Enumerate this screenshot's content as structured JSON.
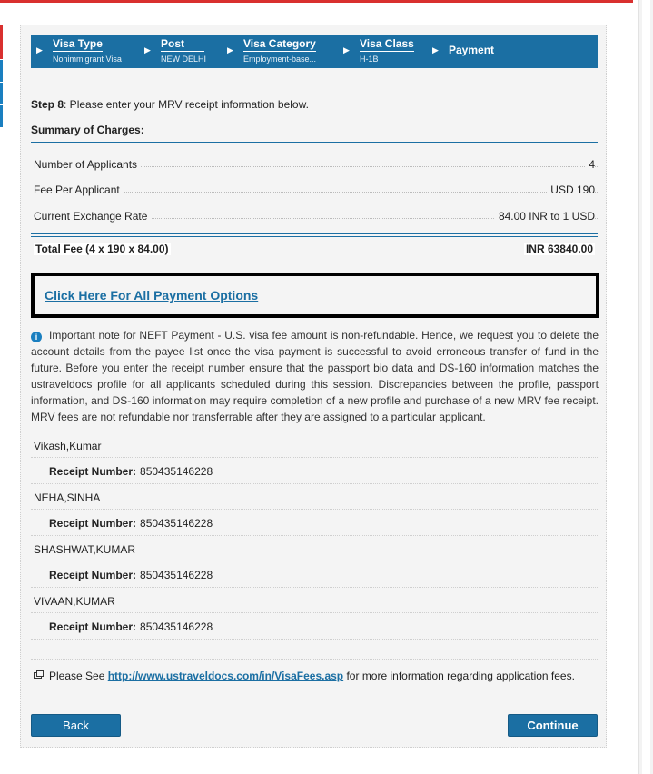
{
  "breadcrumbs": [
    {
      "title": "Visa Type",
      "subtitle": "Nonimmigrant Visa"
    },
    {
      "title": "Post",
      "subtitle": "NEW DELHI"
    },
    {
      "title": "Visa Category",
      "subtitle": "Employment-base..."
    },
    {
      "title": "Visa Class",
      "subtitle": "H-1B"
    },
    {
      "title": "Payment",
      "subtitle": ""
    }
  ],
  "step": {
    "label": "Step 8",
    "text": ": Please enter your MRV receipt information below."
  },
  "summary": {
    "heading": "Summary of Charges:",
    "rows": [
      {
        "label": "Number of Applicants",
        "value": "4"
      },
      {
        "label": "Fee Per Applicant",
        "value": "USD 190"
      },
      {
        "label": "Current Exchange Rate",
        "value": "84.00 INR to 1 USD"
      }
    ],
    "total_label": "Total Fee (4 x 190 x 84.00)",
    "total_value": "INR 63840.00"
  },
  "payment_link": "Click Here For All Payment Options",
  "note": "Important note for NEFT Payment - U.S. visa fee amount is non-refundable. Hence, we request you to delete the account details from the payee list once the visa payment is successful to avoid erroneous transfer of fund in the future. Before you enter the receipt number ensure that the passport bio data and DS-160 information matches the ustraveldocs profile for all applicants scheduled during this session. Discrepancies between the profile, passport information, and DS-160 information may require completion of a new profile and purchase of a new MRV fee receipt. MRV fees are not refundable nor transferrable after they are assigned to a particular applicant.",
  "receipt_label": "Receipt Number:",
  "applicants": [
    {
      "name": "Vikash,Kumar",
      "receipt": "850435146228"
    },
    {
      "name": "NEHA,SINHA",
      "receipt": "850435146228"
    },
    {
      "name": "SHASHWAT,KUMAR",
      "receipt": "850435146228"
    },
    {
      "name": "VIVAAN,KUMAR",
      "receipt": "850435146228"
    }
  ],
  "fees_note": {
    "prefix": "Please See ",
    "link": "http://www.ustraveldocs.com/in/VisaFees.asp",
    "suffix": " for more information regarding application fees."
  },
  "buttons": {
    "back": "Back",
    "continue": "Continue"
  },
  "colors": {
    "brand_blue": "#1b6fa3",
    "accent_red": "#d9302f"
  },
  "icons": {
    "info": "info-icon",
    "external": "external-link-icon",
    "chevron": "chevron-right-icon"
  }
}
